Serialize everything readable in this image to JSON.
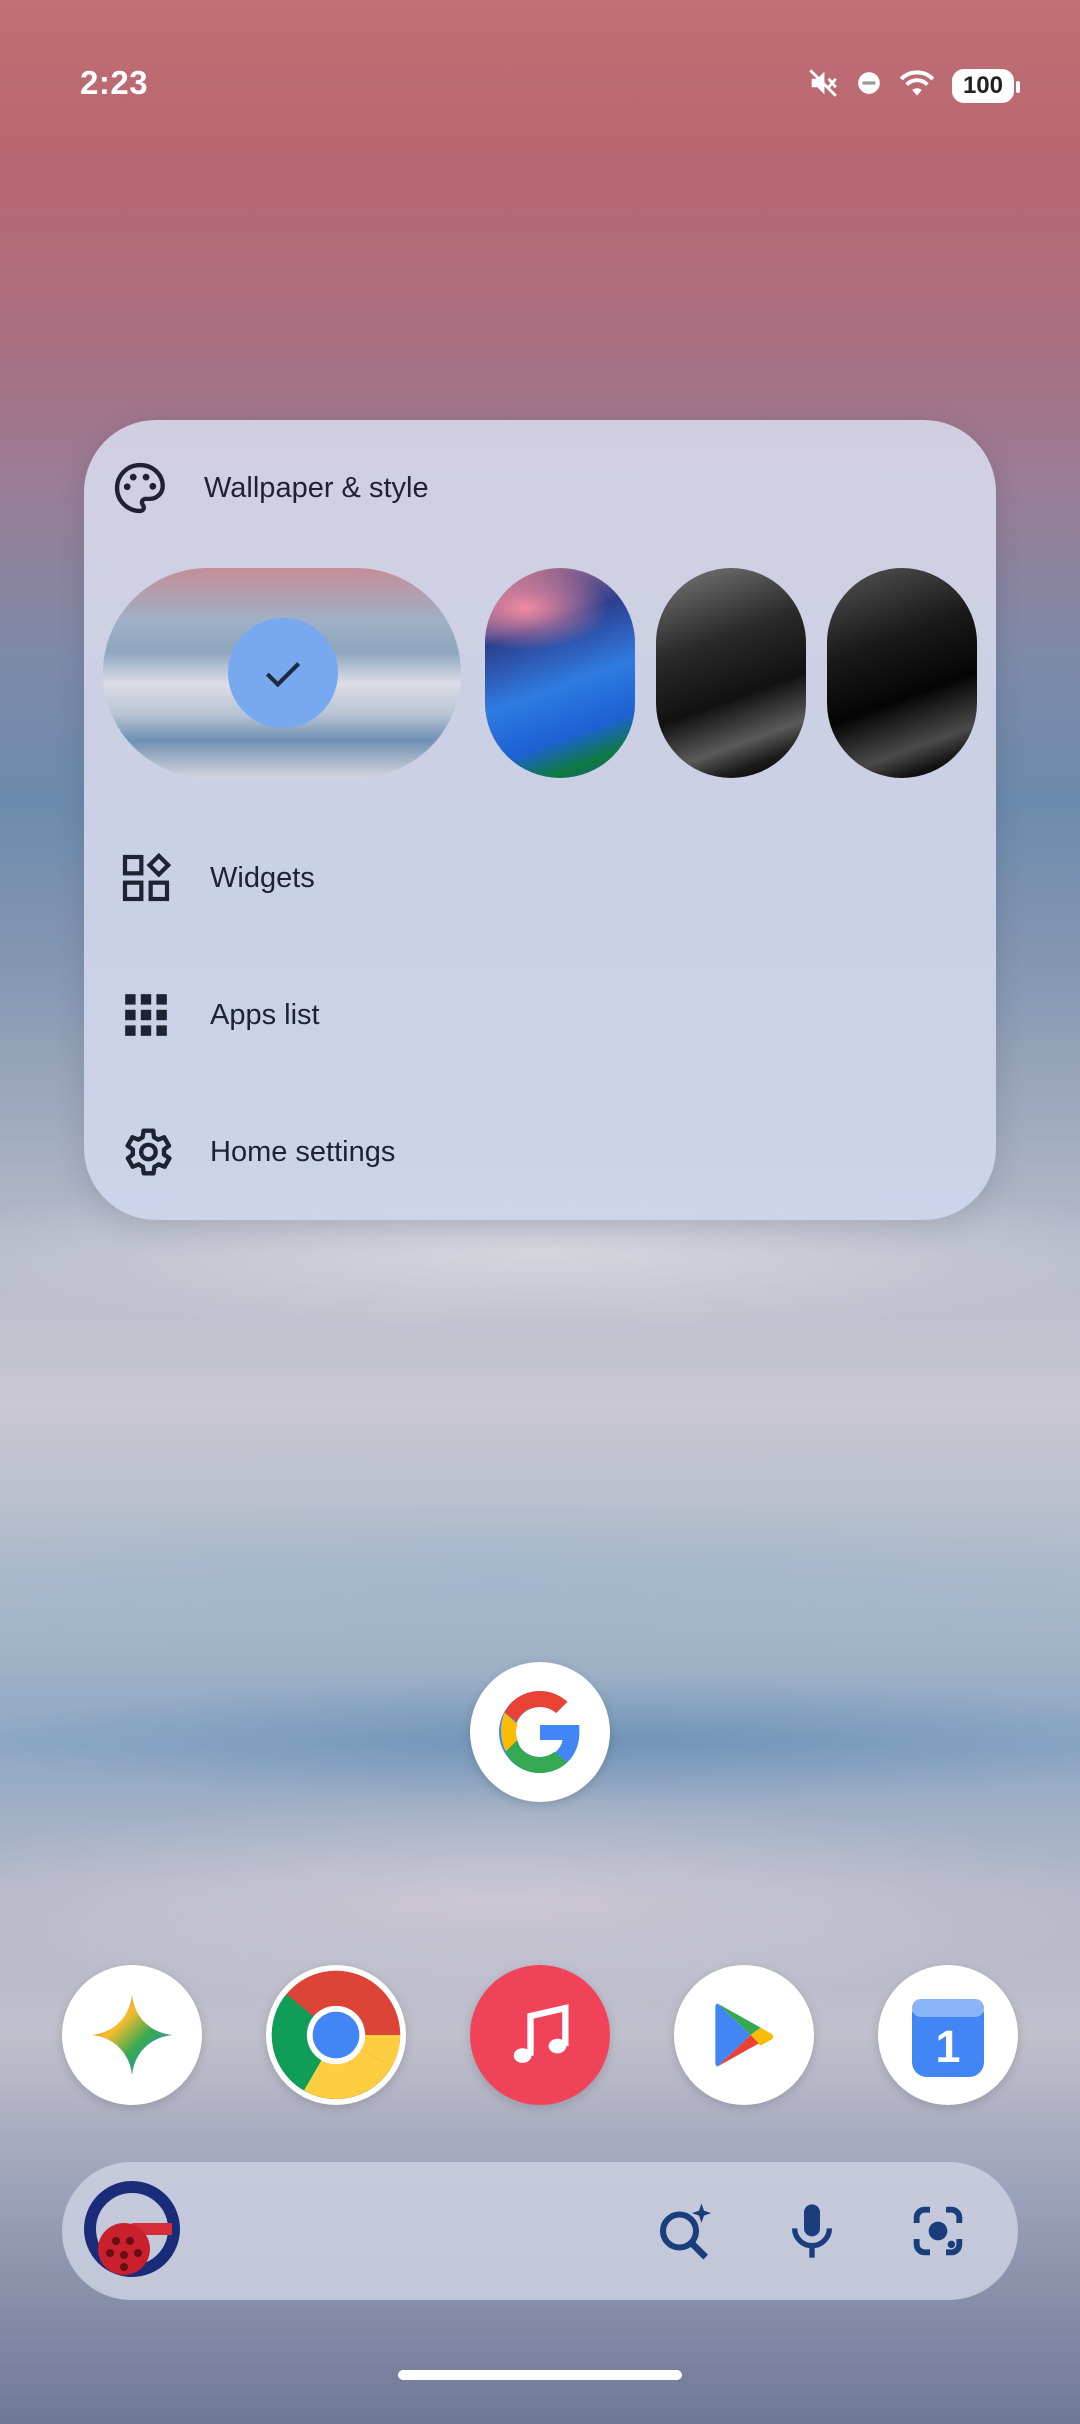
{
  "status_bar": {
    "time": "2:23",
    "battery": "100",
    "icons": [
      "mute-icon",
      "do-not-disturb-icon",
      "wifi-icon",
      "battery-icon"
    ]
  },
  "menu": {
    "wallpaper_label": "Wallpaper & style",
    "widgets_label": "Widgets",
    "apps_list_label": "Apps list",
    "home_settings_label": "Home settings"
  },
  "wallpapers": [
    {
      "name": "fog-landscape",
      "selected": true
    },
    {
      "name": "blue-abstract",
      "selected": false
    },
    {
      "name": "black-silk",
      "selected": false
    },
    {
      "name": "black-silk-dark",
      "selected": false
    }
  ],
  "apps": {
    "google": "Google",
    "dock": [
      "Gemini",
      "Chrome",
      "Music",
      "Play Store",
      "Calendar"
    ],
    "calendar_day": "1"
  },
  "search_bar": {
    "icons": [
      "google-logo-icon",
      "ai-search-icon",
      "microphone-icon",
      "lens-camera-icon"
    ]
  },
  "colors": {
    "menu_text": "#1f2233",
    "selected_check": "#78a9f0",
    "accent": "#1a3e7c"
  }
}
